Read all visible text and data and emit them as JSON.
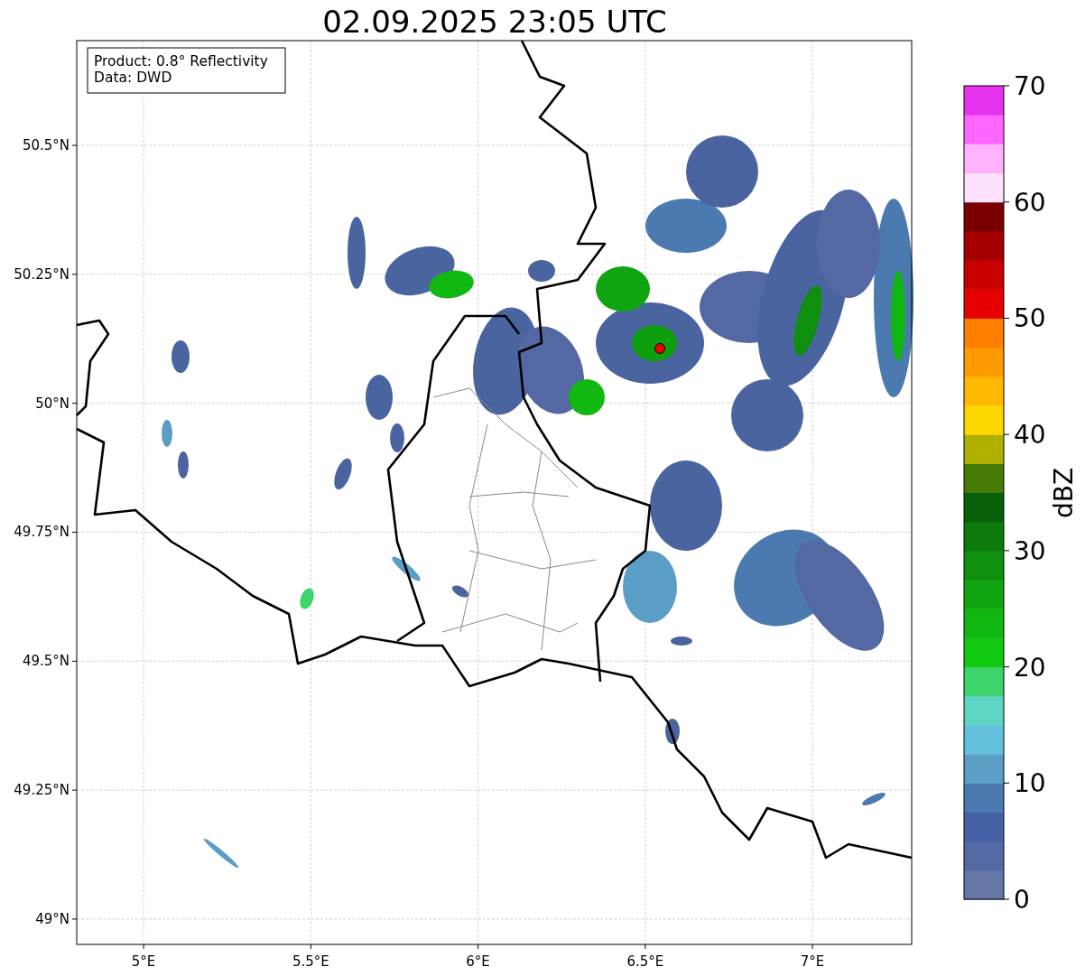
{
  "title": "02.09.2025 23:05 UTC",
  "legend": [
    "Product: 0.8° Reflectivity",
    "Data: DWD"
  ],
  "map": {
    "x_tick_labels": [
      "5°E",
      "5.5°E",
      "6°E",
      "6.5°E",
      "7°E"
    ],
    "y_tick_labels": [
      "50.5°N",
      "50.25°N",
      "50°N",
      "49.75°N",
      "49.5°N",
      "49.25°N",
      "49°N"
    ]
  },
  "colorbar": {
    "label": "dBZ",
    "tick_labels": [
      "70",
      "60",
      "50",
      "40",
      "30",
      "20",
      "10",
      "0"
    ],
    "bands": [
      {
        "color": "#6577a6"
      },
      {
        "color": "#5468a4"
      },
      {
        "color": "#4561a5"
      },
      {
        "color": "#4a7ab0"
      },
      {
        "color": "#5a9ec6"
      },
      {
        "color": "#64c1dd"
      },
      {
        "color": "#5fd6c4"
      },
      {
        "color": "#3dd36d"
      },
      {
        "color": "#12c912"
      },
      {
        "color": "#12b812"
      },
      {
        "color": "#10a510"
      },
      {
        "color": "#0e8f0e"
      },
      {
        "color": "#0b7a0b"
      },
      {
        "color": "#075f07"
      },
      {
        "color": "#467a07"
      },
      {
        "color": "#b0b000"
      },
      {
        "color": "#ffd700"
      },
      {
        "color": "#ffb900"
      },
      {
        "color": "#ff9b00"
      },
      {
        "color": "#ff7f00"
      },
      {
        "color": "#e60000"
      },
      {
        "color": "#c80000"
      },
      {
        "color": "#a50000"
      },
      {
        "color": "#7a0000"
      },
      {
        "color": "#ffe0ff"
      },
      {
        "color": "#ffb3ff"
      },
      {
        "color": "#ff66ff"
      },
      {
        "color": "#e633ee"
      }
    ]
  }
}
